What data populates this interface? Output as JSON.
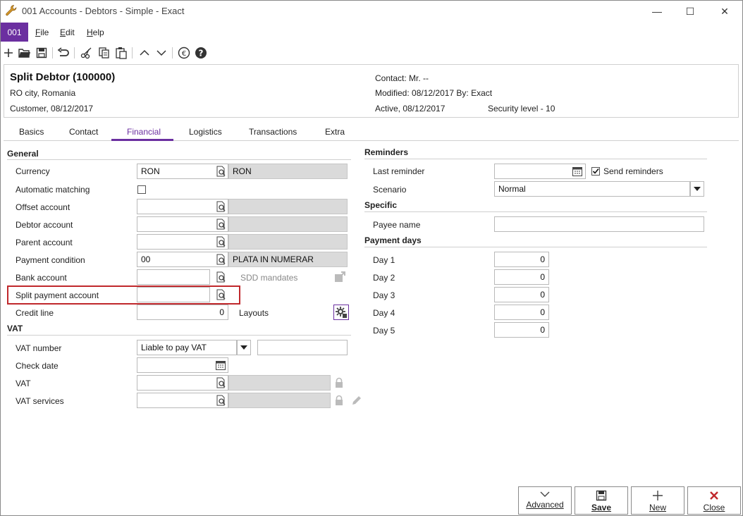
{
  "window": {
    "title": "001 Accounts - Debtors - Simple - Exact",
    "minimize": "—",
    "maximize": "☐",
    "close": "✕"
  },
  "menu": {
    "code": "001",
    "items": [
      {
        "label": "File",
        "accel": "F",
        "rest": "ile"
      },
      {
        "label": "Edit",
        "accel": "E",
        "rest": "dit"
      },
      {
        "label": "Help",
        "accel": "H",
        "rest": "elp"
      }
    ]
  },
  "toolbar": {
    "icons": [
      "add-icon",
      "open-folder-icon",
      "save-icon",
      "undo-icon",
      "cut-icon",
      "copy-icon",
      "paste-icon",
      "previous-icon",
      "next-icon",
      "euro-icon",
      "help-icon"
    ]
  },
  "header": {
    "name": "Split Debtor (100000)",
    "location": "RO city, Romania",
    "customer": "Customer, 08/12/2017",
    "contact": "Contact: Mr. --",
    "modified": "Modified: 08/12/2017  By: Exact",
    "active": "Active, 08/12/2017",
    "security": "Security level - 10"
  },
  "tabs": [
    "Basics",
    "Contact",
    "Financial",
    "Logistics",
    "Transactions",
    "Extra"
  ],
  "active_tab": "Financial",
  "general": {
    "title": "General",
    "currency_label": "Currency",
    "currency_value": "RON",
    "currency_desc": "RON",
    "automatic_matching_label": "Automatic matching",
    "offset_account_label": "Offset account",
    "debtor_account_label": "Debtor account",
    "parent_account_label": "Parent account",
    "payment_condition_label": "Payment condition",
    "payment_condition_value": "00",
    "payment_condition_desc": "PLATA IN NUMERAR",
    "bank_account_label": "Bank account",
    "sdd_mandates_label": "SDD mandates",
    "split_payment_label": "Split payment account",
    "credit_line_label": "Credit line",
    "credit_line_value": "0",
    "layouts_label": "Layouts"
  },
  "vat": {
    "title": "VAT",
    "vat_number_label": "VAT number",
    "vat_number_select": "Liable to pay VAT",
    "check_date_label": "Check date",
    "vat_label": "VAT",
    "vat_services_label": "VAT services"
  },
  "reminders": {
    "title": "Reminders",
    "last_reminder_label": "Last reminder",
    "send_reminders_label": "Send reminders",
    "send_reminders_checked": true,
    "scenario_label": "Scenario",
    "scenario_value": "Normal"
  },
  "specific": {
    "title": "Specific",
    "payee_name_label": "Payee name"
  },
  "payment_days": {
    "title": "Payment days",
    "days": [
      {
        "label": "Day 1",
        "value": "0"
      },
      {
        "label": "Day 2",
        "value": "0"
      },
      {
        "label": "Day 3",
        "value": "0"
      },
      {
        "label": "Day 4",
        "value": "0"
      },
      {
        "label": "Day 5",
        "value": "0"
      }
    ]
  },
  "buttons": {
    "advanced": "Advanced",
    "save": "Save",
    "new": "New",
    "close": "Close"
  },
  "colors": {
    "accent": "#6b2fa0",
    "highlight": "#c0282c",
    "close_red": "#c0282c"
  }
}
